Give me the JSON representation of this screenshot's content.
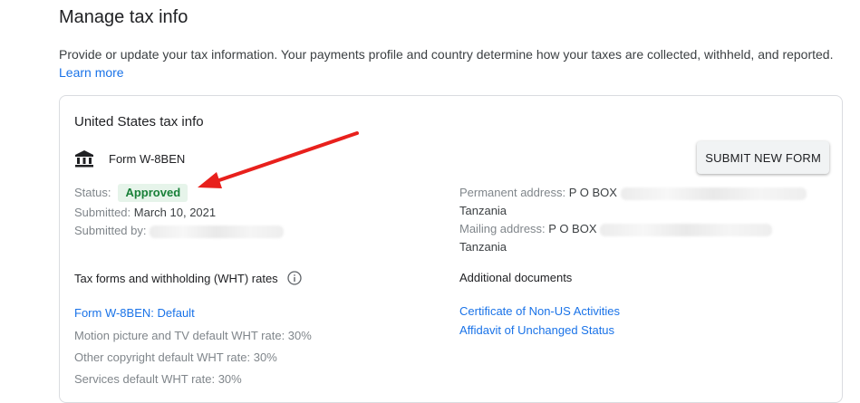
{
  "header": {
    "title": "Manage tax info",
    "intro": "Provide or update your tax information. Your payments profile and country determine how your taxes are collected, withheld, and reported.",
    "learn_more": "Learn more"
  },
  "card": {
    "title": "United States tax info",
    "form_icon": "bank-icon",
    "form_name": "Form W-8BEN",
    "submit_button": "SUBMIT NEW FORM",
    "status_label": "Status:",
    "status_value": "Approved",
    "status_color": "#188038",
    "submitted_label": "Submitted:",
    "submitted_value": "March 10, 2021",
    "submitted_by_label": "Submitted by:",
    "permanent_label": "Permanent address:",
    "permanent_value": "P O BOX",
    "permanent_country": "Tanzania",
    "mailing_label": "Mailing address:",
    "mailing_value": "P O BOX",
    "mailing_country": "Tanzania",
    "wht": {
      "heading": "Tax forms and withholding (WHT) rates",
      "info_icon": "info-icon",
      "form_link": "Form W-8BEN: Default",
      "rates": [
        "Motion picture and TV default WHT rate: 30%",
        "Other copyright default WHT rate: 30%",
        "Services default WHT rate: 30%"
      ]
    },
    "additional": {
      "heading": "Additional documents",
      "docs": [
        "Certificate of Non-US Activities",
        "Affidavit of Unchanged Status"
      ]
    }
  },
  "annotation": {
    "arrow_color": "#e8201c"
  }
}
